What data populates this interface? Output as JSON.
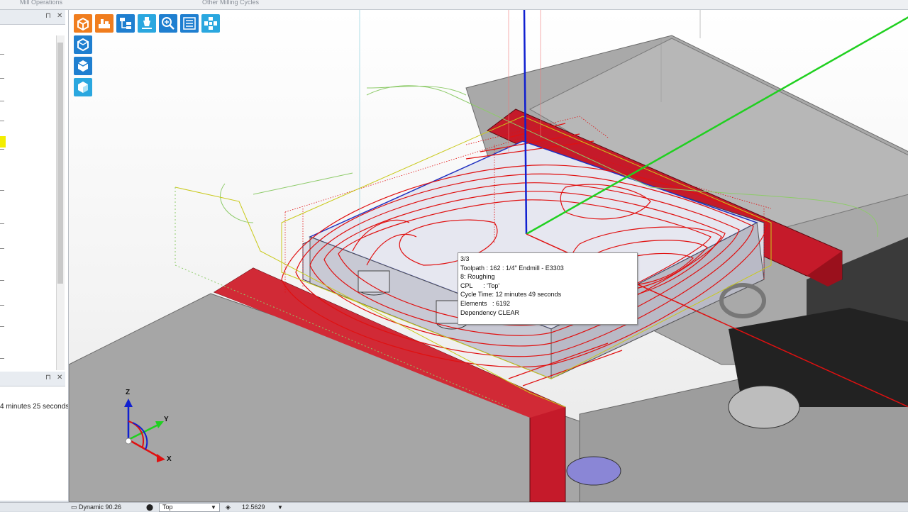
{
  "ribbon": {
    "groups": [
      "Mill Operations",
      "Other Milling Cycles"
    ]
  },
  "left_panel": {
    "pin_icon": "pin-icon",
    "cycle_time_fragment": "4 minutes 25 seconds"
  },
  "toolbar": {
    "icons": [
      {
        "name": "solid-box-icon",
        "color": "#f07d1e"
      },
      {
        "name": "machine-icon",
        "color": "#f07d1e"
      },
      {
        "name": "operation-tree-icon",
        "color": "#1f7fd0"
      },
      {
        "name": "tool-icon",
        "color": "#2aa7df"
      },
      {
        "name": "zoom-icon",
        "color": "#1f7fd0"
      },
      {
        "name": "list-icon",
        "color": "#1f7fd0"
      },
      {
        "name": "move-icon",
        "color": "#2aa7df"
      },
      {
        "name": "view-cube-icon",
        "color": "#1f7fd0"
      },
      {
        "name": "iso-cube-icon",
        "color": "#1f7fd0"
      },
      {
        "name": "stock-icon",
        "color": "#2aa7df"
      }
    ]
  },
  "tooltip": {
    "lines": [
      "3/3",
      "Toolpath : 162 : 1/4\" Endmill - E3303",
      "8: Roughing",
      "CPL      : 'Top'",
      "Cycle Time: 12 minutes 49 seconds",
      "Elements   : 6192",
      "Dependency CLEAR"
    ]
  },
  "axes": {
    "x": "X",
    "y": "Y",
    "z": "Z"
  },
  "status": {
    "view_mode": "Dynamic 90.26",
    "view_select": "Top",
    "zoom_value": "12.5629"
  },
  "colors": {
    "toolpath": "#e01010",
    "part_red": "#c51a2a",
    "stock_grey": "#a8a8a8",
    "axis_x": "#e01010",
    "axis_y": "#20d020",
    "axis_z": "#1020d0"
  }
}
